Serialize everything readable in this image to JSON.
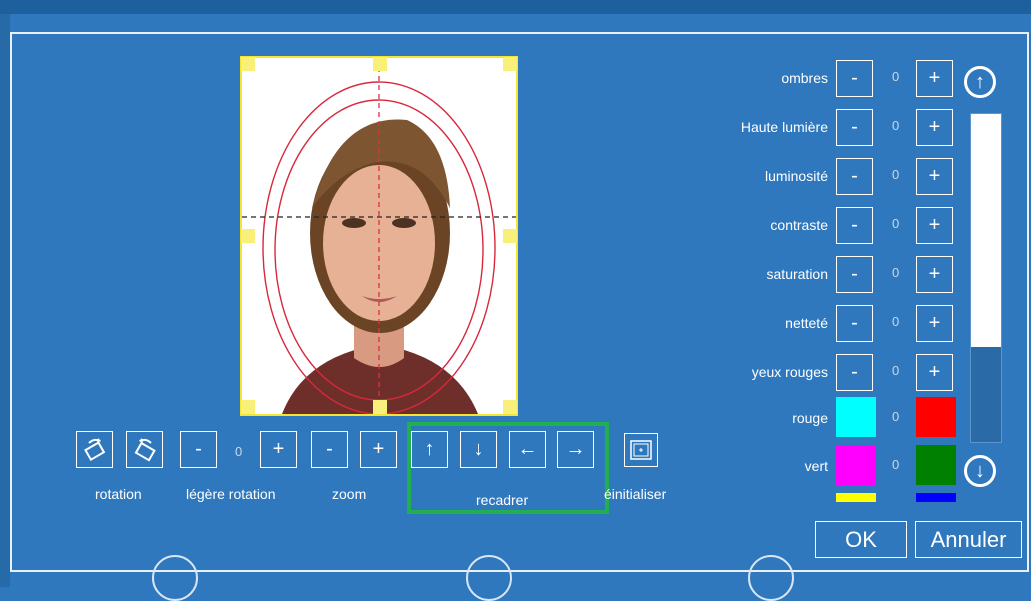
{
  "toolbar": {
    "rotation_label": "rotation",
    "fine_rotation_label": "légère rotation",
    "fine_rotation_value": "0",
    "zoom_label": "zoom",
    "crop_label": "recadrer",
    "reset_label": "éinitialiser",
    "minus": "-",
    "plus": "+",
    "up": "↑",
    "down": "↓",
    "left": "←",
    "right": "→"
  },
  "adjustments": [
    {
      "label": "ombres",
      "value": "0"
    },
    {
      "label": "Haute lumière",
      "value": "0"
    },
    {
      "label": "luminosité",
      "value": "0"
    },
    {
      "label": "contraste",
      "value": "0"
    },
    {
      "label": "saturation",
      "value": "0"
    },
    {
      "label": "netteté",
      "value": "0"
    },
    {
      "label": "yeux rouges",
      "value": "0"
    }
  ],
  "colors": [
    {
      "label": "rouge",
      "value": "0",
      "left": "#00ffff",
      "right": "#ff0000"
    },
    {
      "label": "vert",
      "value": "0",
      "left": "#ff00ff",
      "right": "#008000"
    },
    {
      "label": "",
      "value": "",
      "left": "#ffff00",
      "right": "#0000ff"
    }
  ],
  "slider": {
    "level": 0.71
  },
  "buttons": {
    "ok": "OK",
    "cancel": "Annuler"
  },
  "accent_colors": {
    "crop_highlight": "#20b050",
    "frame": "#f5e430"
  }
}
